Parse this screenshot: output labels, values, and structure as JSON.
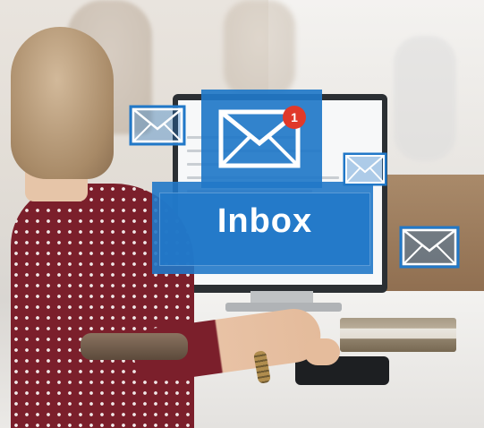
{
  "scene": {
    "inbox_label": "Inbox",
    "notification_count": "1"
  },
  "icons": {
    "main": "envelope-icon",
    "left": "envelope-icon",
    "right_small": "envelope-icon",
    "right_large": "envelope-icon"
  },
  "colors": {
    "accent_blue": "#2178c8",
    "badge_red": "#e0392a",
    "envelope_stroke": "#ffffff",
    "blouse": "#7b1f2b"
  }
}
